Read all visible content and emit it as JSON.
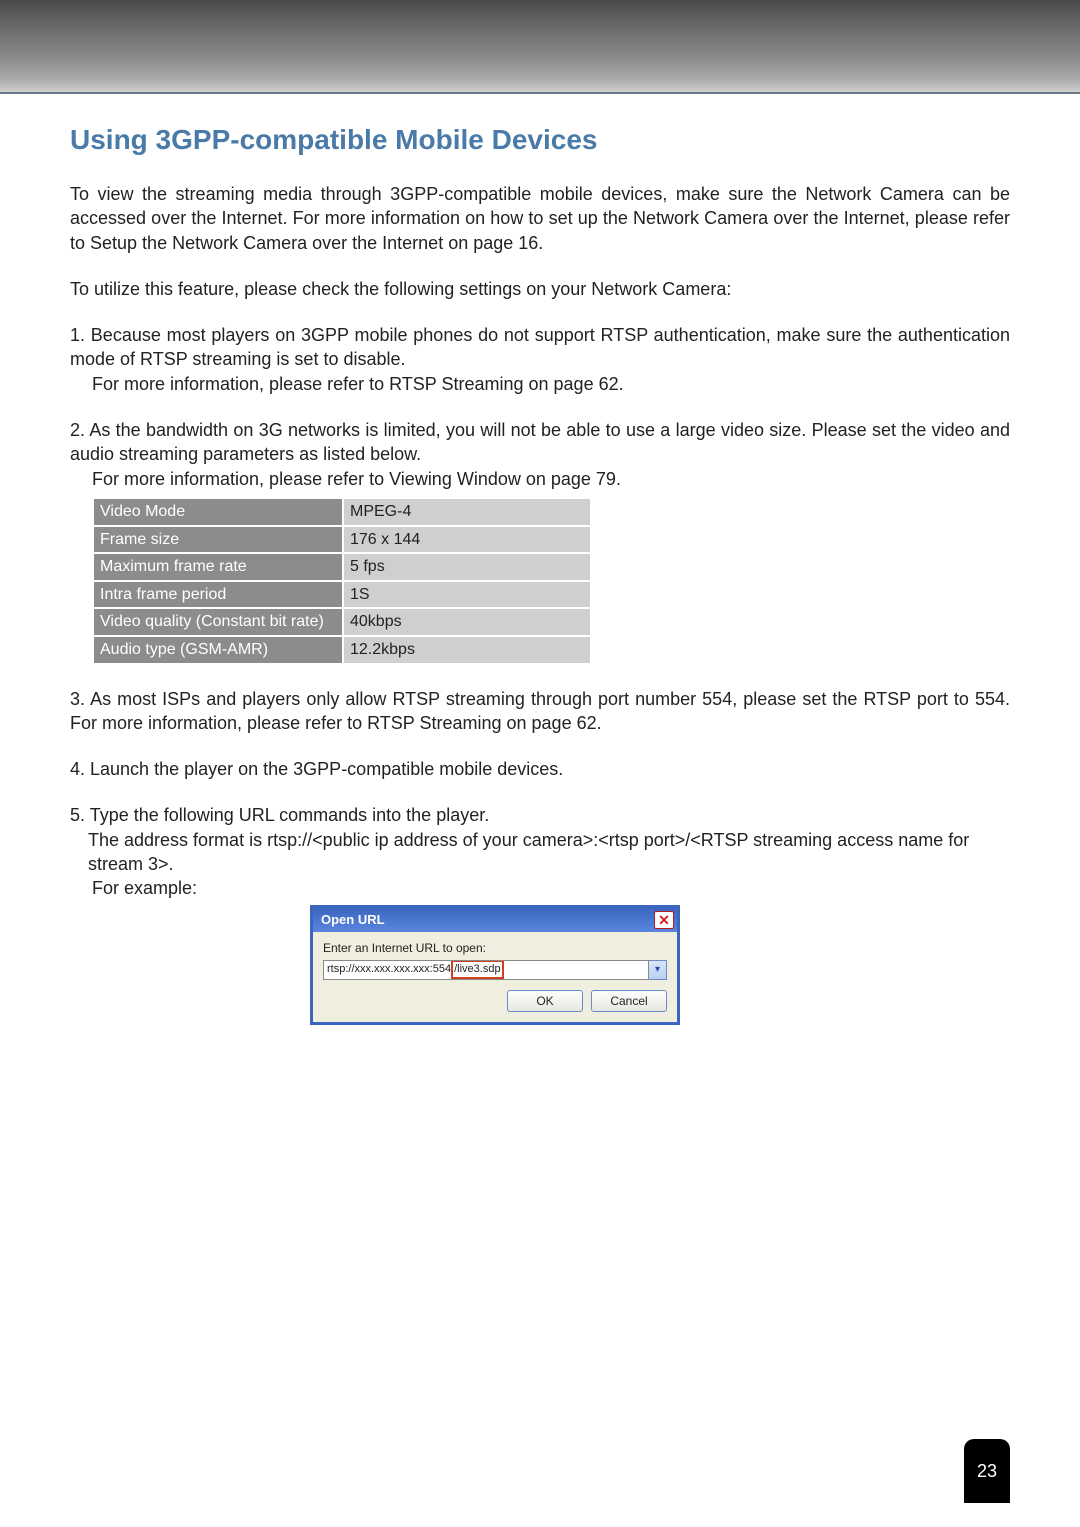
{
  "title": "Using 3GPP-compatible Mobile Devices",
  "intro1": "To view the streaming media through 3GPP-compatible mobile devices, make sure the Network Camera can be accessed over the Internet. For more information on how to set up the Network Camera over the Internet, please refer to Setup the Network Camera over the Internet on page 16.",
  "intro2": "To utilize this feature, please check the following settings on your Network Camera:",
  "items": {
    "i1": {
      "num": "1. ",
      "text": "Because most players on 3GPP mobile phones do not support RTSP authentication, make sure the authentication mode of RTSP streaming is set to disable.",
      "sub": "For more information, please refer to RTSP Streaming on page 62."
    },
    "i2": {
      "num": "2. ",
      "text": "As the bandwidth on 3G networks is limited, you will not be able to use a large video size. Please set the video and audio streaming parameters as listed below.",
      "sub": "For more information, please refer to Viewing Window on page 79."
    },
    "i3": {
      "num": "3. ",
      "text": "As most ISPs and players only allow RTSP streaming through port number 554, please set the RTSP port to 554. For more information, please refer to RTSP Streaming on page 62."
    },
    "i4": {
      "num": "4. ",
      "text": "Launch the player on the 3GPP-compatible mobile devices."
    },
    "i5": {
      "num": "5. ",
      "text": "Type the following URL commands into the player.",
      "line2": "The address format is rtsp://<public ip address of your camera>:<rtsp port>/<RTSP streaming access name for stream 3>.",
      "line3": "For example:"
    }
  },
  "settings_table": [
    {
      "k": "Video Mode",
      "v": "MPEG-4"
    },
    {
      "k": "Frame size",
      "v": "176 x 144"
    },
    {
      "k": "Maximum frame rate",
      "v": "5 fps"
    },
    {
      "k": "Intra frame period",
      "v": "1S"
    },
    {
      "k": "Video quality (Constant bit rate)",
      "v": "40kbps"
    },
    {
      "k": "Audio type (GSM-AMR)",
      "v": "12.2kbps"
    }
  ],
  "dialog": {
    "title": "Open URL",
    "close_glyph": "✕",
    "label": "Enter an Internet URL to open:",
    "url_pre": "rtsp://xxx.xxx.xxx.xxx:554",
    "url_highlight": "/live3.sdp",
    "drop_glyph": "▾",
    "ok": "OK",
    "cancel": "Cancel"
  },
  "page_number": "23"
}
